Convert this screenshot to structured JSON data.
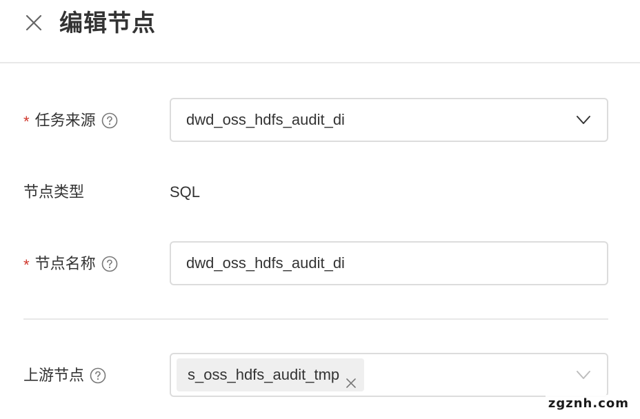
{
  "header": {
    "title": "编辑节点",
    "close_icon": "close-icon"
  },
  "form": {
    "task_source": {
      "label": "任务来源",
      "required_mark": "*",
      "value": "dwd_oss_hdfs_audit_di"
    },
    "node_type": {
      "label": "节点类型",
      "value": "SQL"
    },
    "node_name": {
      "label": "节点名称",
      "required_mark": "*",
      "value": "dwd_oss_hdfs_audit_di"
    },
    "upstream_nodes": {
      "label": "上游节点",
      "tags": [
        "s_oss_hdfs_audit_tmp"
      ]
    }
  },
  "watermark": "zgznh.com",
  "colors": {
    "required": "#d0362b",
    "border": "#dcdcdc",
    "tag_bg": "#efefef"
  }
}
